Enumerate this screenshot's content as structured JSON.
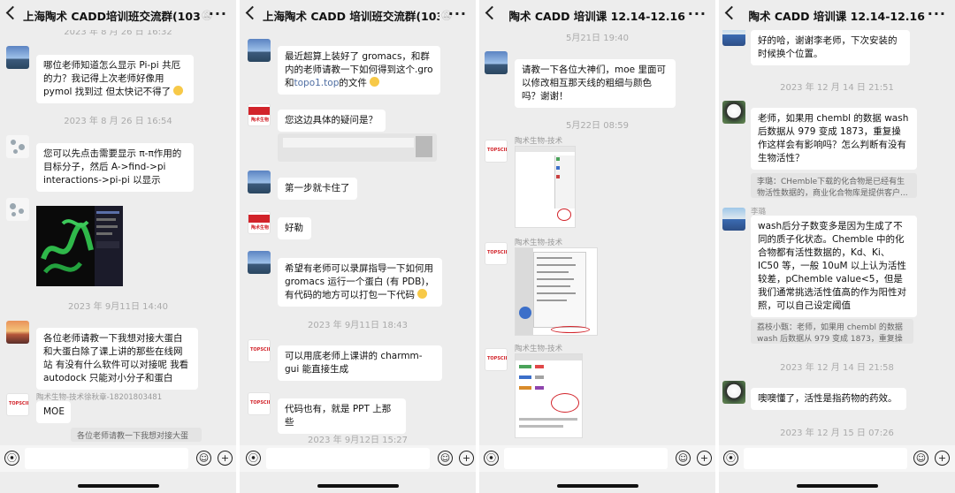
{
  "panels": [
    {
      "title": "上海陶术 CADD培训班交流群(103)",
      "messages": {
        "ts1": "2023 年 8 月 26 日 16:32",
        "m1": "哪位老师知道怎么显示 Pi-pi 共厄的力？我记得上次老师好像用 pymol 找到过 但太快记不得了",
        "ts2": "2023 年 8 月 26 日 16:54",
        "m2": "您可以先点击需要显示 π-π作用的目标分子，然后 A->find->pi interactions->pi-pi 以显示",
        "ts3": "2023 年 9月11日 14:40",
        "m3": "各位老师请教一下我想对接大蛋白和大蛋白除了课上讲的那些在线网站 有没有什么软件可以对接呢 我看 autodock 只能对小分子和蛋白",
        "sender4": "陶术生物-技术徐秋章-18201803481",
        "m4": "MOE",
        "quote4": "各位老师请教一下我想对接大蛋白"
      }
    },
    {
      "title": "上海陶术 CADD 培训班交流群(103)",
      "messages": {
        "m1a": "最近超算上装好了 gromacs，和群内的老师请教一下如何得到这个.gro 和",
        "m1link": "topo1.top",
        "m1b": "的文件",
        "m2": "您这边具体的疑问是？",
        "m3": "第一步就卡住了",
        "m4": "好勒",
        "m5": "希望有老师可以录屏指导一下如何用 gromacs 运行一个蛋白 (有 PDB)，有代码的地方可以打包一下代码",
        "ts1": "2023 年 9月11日 18:43",
        "m6": "可以用底老师上课讲的 charmm-gui 能直接生成",
        "m7": "代码也有，就是 PPT 上那些",
        "ts2": "2023 年 9月12日 15:27"
      }
    },
    {
      "title": "陶术 CADD 培训课 12.14-12.16(59)",
      "messages": {
        "ts1": "5月21日 19:40",
        "m1": "请教一下各位大神们，moe 里面可以修改相互那天线的粗细与颜色吗？谢谢！",
        "ts2": "5月22日 08:59",
        "sender1": "陶术生物-技术",
        "sender2": "陶术生物-技术",
        "sender3": "陶术生物-技术"
      }
    },
    {
      "title": "陶术 CADD 培训课 12.14-12.16(59)",
      "messages": {
        "m1": "好的哈，谢谢李老师，下次安装的时候换个位置。",
        "ts1": "2023 年 12 月 14 日 21:51",
        "m2": "老师，如果用 chembl 的数据 wash 后数据从 979 变成 1873，重复操作这样会有影响吗？怎么判断有没有生物活性？",
        "quote2": "李璐：CHemble下载的化合物是已经有生物活性数据的，商业化合物库是提供客户...",
        "sender3": "李璐",
        "m3": "wash后分子数变多是因为生成了不同的质子化状态。Chemble 中的化合物都有活性数据的，Kd、Ki、IC50 等，一般 10uM 以上认为活性较差，pChemble value<5，但是我们通常挑选活性值高的作为阳性对照，可以自己设定阈值",
        "quote3": "荔枝小甄：老师，如果用 chembl 的数据 wash 后数据从 979 变成 1873，重复操作...",
        "ts2": "2023 年 12 月 14 日 21:58",
        "m4": "噢噢懂了，活性是指药物的药效。",
        "ts3": "2023 年 12 月 15 日 07:26"
      }
    }
  ],
  "icons": [
    "back-icon",
    "more-icon",
    "voice-icon",
    "emoji-icon",
    "plus-icon"
  ],
  "colors": {
    "background": "#ededed",
    "bubble": "#ffffff",
    "link": "#4f6ea3",
    "brand_red": "#d2232a"
  }
}
